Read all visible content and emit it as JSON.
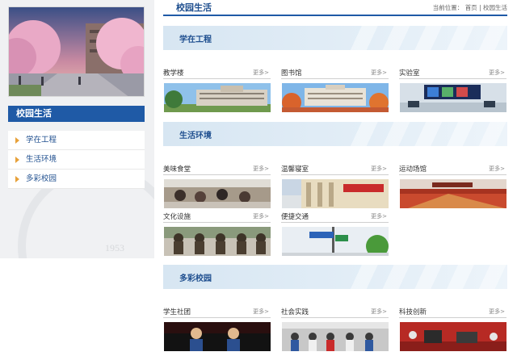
{
  "sidebar": {
    "title": "校园生活",
    "items": [
      {
        "label": "学在工程"
      },
      {
        "label": "生活环境"
      },
      {
        "label": "多彩校园"
      }
    ],
    "watermark_year": "1953"
  },
  "header": {
    "title": "校园生活",
    "breadcrumb_prefix": "当前位置：",
    "breadcrumb_home": "首页",
    "breadcrumb_sep": "|",
    "breadcrumb_current": "校园生活"
  },
  "sections": [
    {
      "title": "学在工程",
      "cards": [
        {
          "title": "教学楼",
          "more": "更多>"
        },
        {
          "title": "图书馆",
          "more": "更多>"
        },
        {
          "title": "实验室",
          "more": "更多>"
        }
      ]
    },
    {
      "title": "生活环境",
      "cards": [
        {
          "title": "美味食堂",
          "more": "更多>"
        },
        {
          "title": "温馨寝室",
          "more": "更多>"
        },
        {
          "title": "运动场馆",
          "more": "更多>"
        },
        {
          "title": "文化设施",
          "more": "更多>"
        },
        {
          "title": "便捷交通",
          "more": "更多>"
        }
      ]
    },
    {
      "title": "多彩校园",
      "cards": [
        {
          "title": "学生社团",
          "more": "更多>"
        },
        {
          "title": "社会实践",
          "more": "更多>"
        },
        {
          "title": "科技创新",
          "more": "更多>"
        }
      ]
    }
  ],
  "colors": {
    "primary": "#1f5aa6",
    "accent": "#e7a13a",
    "banner": "#d7e6f2"
  }
}
